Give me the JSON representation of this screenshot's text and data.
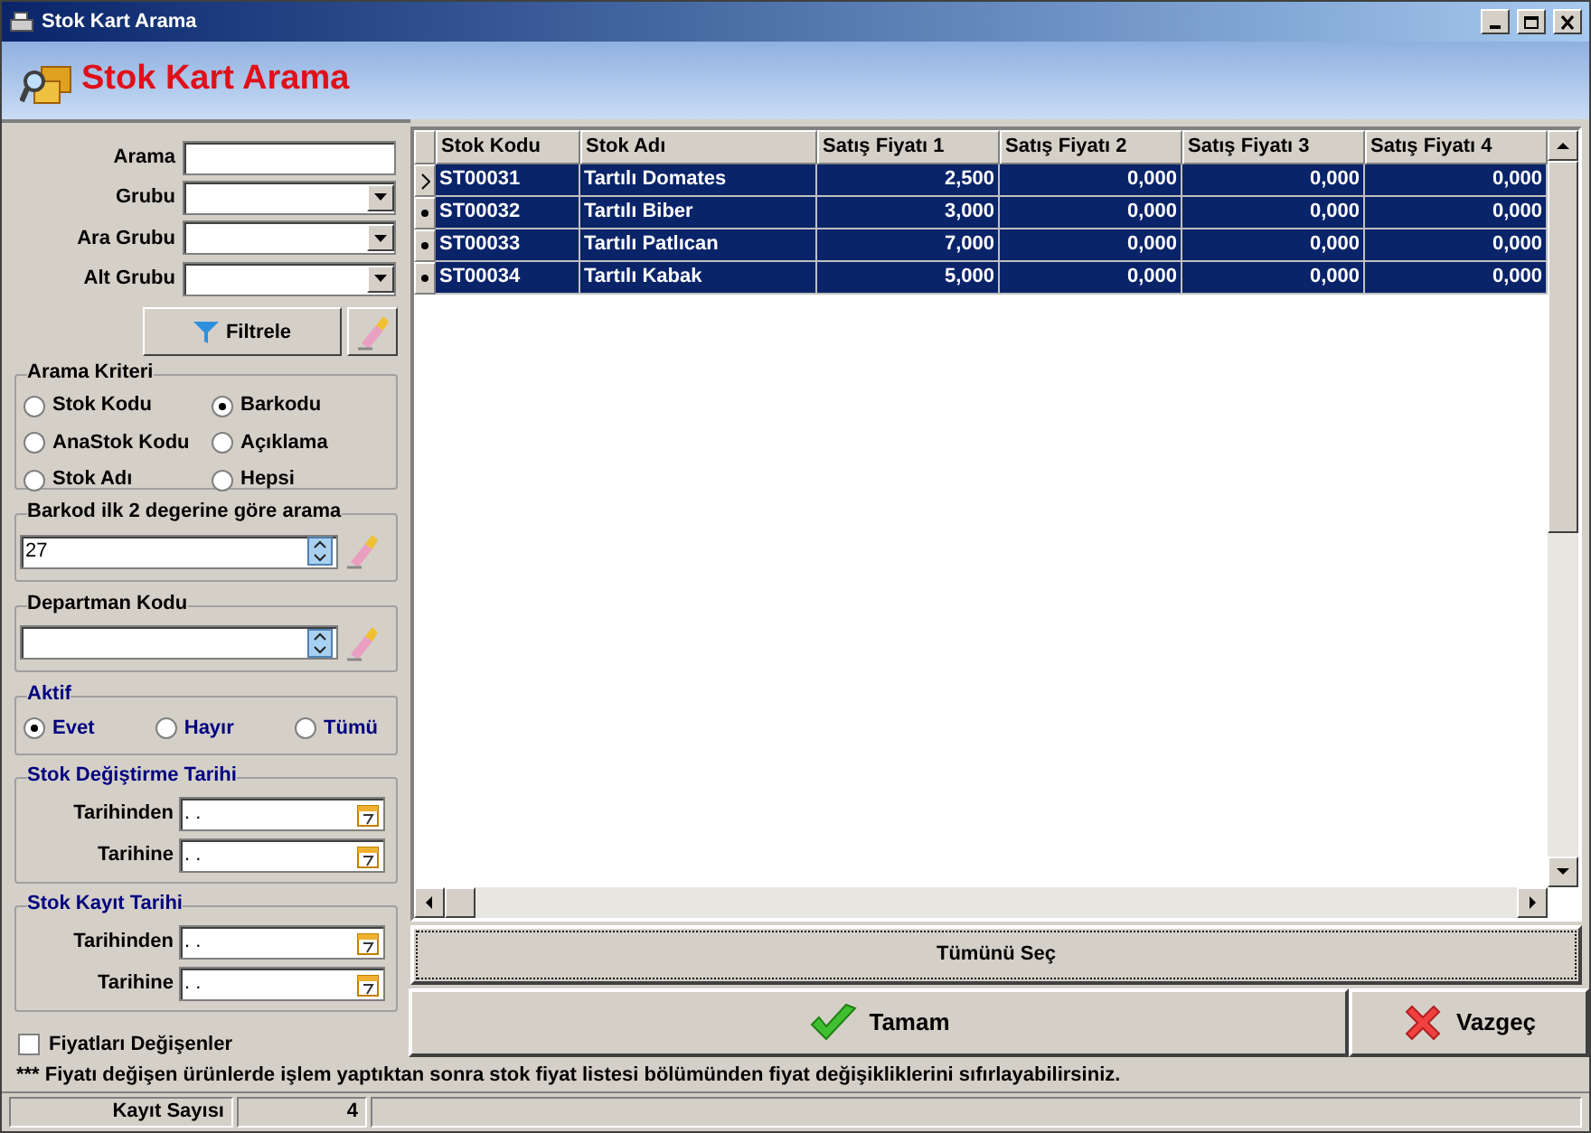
{
  "window": {
    "title": "Stok Kart Arama"
  },
  "header": {
    "title": "Stok Kart Arama"
  },
  "filters": [
    {
      "label": "Arama",
      "kind": "text"
    },
    {
      "label": "Grubu",
      "kind": "combo"
    },
    {
      "label": "Ara Grubu",
      "kind": "combo"
    },
    {
      "label": "Alt Grubu",
      "kind": "combo"
    }
  ],
  "filter_button": "Filtrele",
  "search_criteria": {
    "title": "Arama Kriteri",
    "options": [
      {
        "label": "Stok Kodu",
        "selected": false
      },
      {
        "label": "Barkodu",
        "selected": true
      },
      {
        "label": "AnaStok Kodu",
        "selected": false
      },
      {
        "label": "Açıklama",
        "selected": false
      },
      {
        "label": "Stok Adı",
        "selected": false
      },
      {
        "label": "Hepsi",
        "selected": false
      }
    ]
  },
  "barcode": {
    "title": "Barkod ilk 2 degerine göre arama",
    "value": "27"
  },
  "department": {
    "title": "Departman Kodu"
  },
  "active": {
    "title": "Aktif",
    "options": [
      {
        "label": "Evet",
        "selected": true
      },
      {
        "label": "Hayır",
        "selected": false
      },
      {
        "label": "Tümü",
        "selected": false
      }
    ]
  },
  "date_groups": [
    {
      "title": "Stok Değiştirme Tarihi",
      "fields": [
        {
          "label": "Tarihinden",
          "value": ". ."
        },
        {
          "label": "Tarihine",
          "value": ". ."
        }
      ]
    },
    {
      "title": "Stok Kayıt Tarihi",
      "fields": [
        {
          "label": "Tarihinden",
          "value": ". ."
        },
        {
          "label": "Tarihine",
          "value": ". ."
        }
      ]
    }
  ],
  "price_changed": {
    "label": "Fiyatları Değişenler",
    "checked": false
  },
  "table": {
    "columns": [
      "Stok Kodu",
      "Stok Adı",
      "Satış Fiyatı 1",
      "Satış Fiyatı 2",
      "Satış Fiyatı 3",
      "Satış Fiyatı 4"
    ],
    "rows": [
      {
        "current": true,
        "selected": true,
        "cells": [
          "ST00031",
          "Tartılı Domates",
          "2,500",
          "0,000",
          "0,000",
          "0,000"
        ]
      },
      {
        "current": false,
        "selected": true,
        "cells": [
          "ST00032",
          "Tartılı Biber",
          "3,000",
          "0,000",
          "0,000",
          "0,000"
        ]
      },
      {
        "current": false,
        "selected": true,
        "cells": [
          "ST00033",
          "Tartılı Patlıcan",
          "7,000",
          "0,000",
          "0,000",
          "0,000"
        ]
      },
      {
        "current": false,
        "selected": true,
        "cells": [
          "ST00034",
          "Tartılı Kabak",
          "5,000",
          "0,000",
          "0,000",
          "0,000"
        ]
      }
    ]
  },
  "select_all_button": "Tümünü Seç",
  "ok_button": "Tamam",
  "cancel_button": "Vazgeç",
  "note": "*** Fiyatı değişen ürünlerde işlem yaptıktan sonra stok fiyat listesi bölümünden fiyat değişikliklerini sıfırlayabilirsiniz.",
  "status_bar": {
    "label": "Kayıt Sayısı",
    "count": "4"
  }
}
